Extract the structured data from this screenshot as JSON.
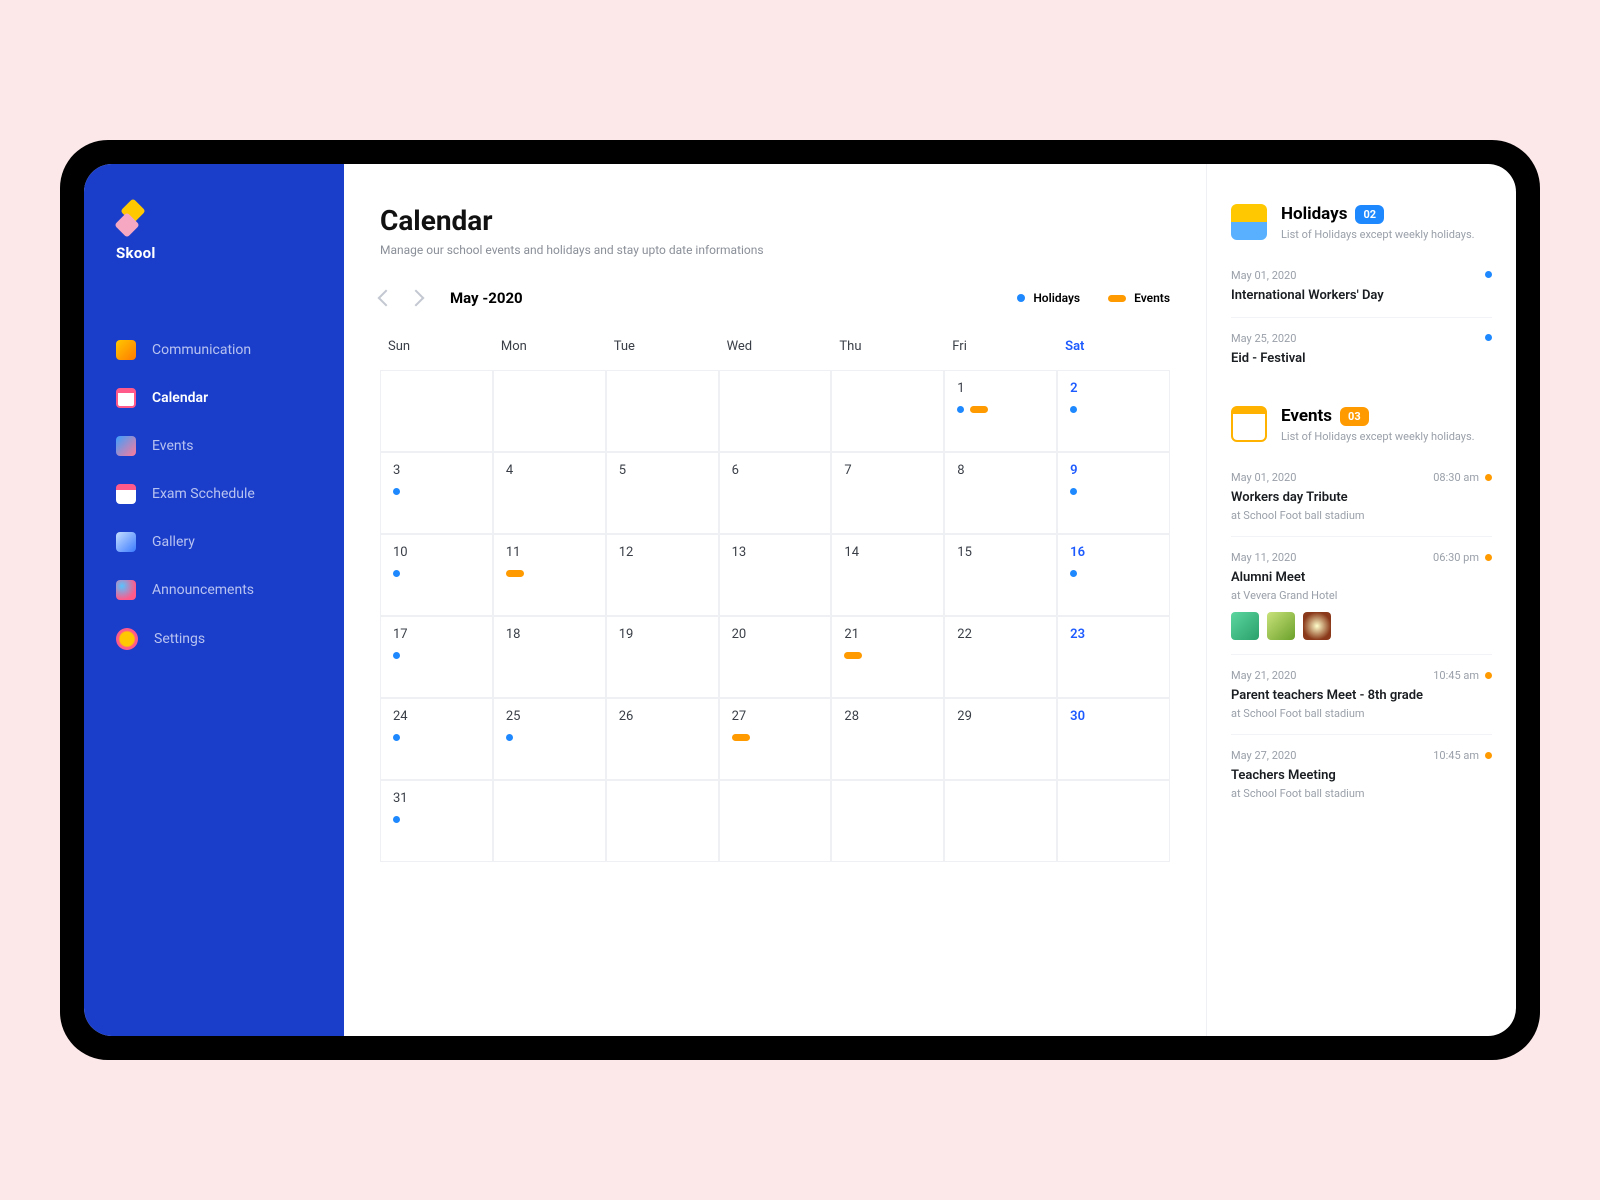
{
  "brand": "Skool",
  "sidebar": {
    "items": [
      {
        "label": "Communication"
      },
      {
        "label": "Calendar"
      },
      {
        "label": "Events"
      },
      {
        "label": "Exam Scchedule"
      },
      {
        "label": "Gallery"
      },
      {
        "label": "Announcements"
      },
      {
        "label": "Settings"
      }
    ]
  },
  "page": {
    "title": "Calendar",
    "subtitle": "Manage our school events and holidays  and stay upto date informations"
  },
  "calendar": {
    "month_label": "May -2020",
    "legend_holidays": "Holidays",
    "legend_events": "Events",
    "weekdays": [
      "Sun",
      "Mon",
      "Tue",
      "Wed",
      "Thu",
      "Fri",
      "Sat"
    ],
    "cells": [
      [
        {
          "n": ""
        },
        {
          "n": ""
        },
        {
          "n": ""
        },
        {
          "n": ""
        },
        {
          "n": ""
        },
        {
          "n": "1",
          "blue": true,
          "orange": true
        },
        {
          "n": "2",
          "blue": true,
          "sat": true
        }
      ],
      [
        {
          "n": "3",
          "blue": true
        },
        {
          "n": "4"
        },
        {
          "n": "5"
        },
        {
          "n": "6"
        },
        {
          "n": "7"
        },
        {
          "n": "8"
        },
        {
          "n": "9",
          "blue": true,
          "sat": true
        }
      ],
      [
        {
          "n": "10",
          "blue": true
        },
        {
          "n": "11",
          "orange": true
        },
        {
          "n": "12"
        },
        {
          "n": "13"
        },
        {
          "n": "14"
        },
        {
          "n": "15"
        },
        {
          "n": "16",
          "blue": true,
          "sat": true
        }
      ],
      [
        {
          "n": "17",
          "blue": true
        },
        {
          "n": "18"
        },
        {
          "n": "19"
        },
        {
          "n": "20"
        },
        {
          "n": "21",
          "orange": true
        },
        {
          "n": "22"
        },
        {
          "n": "23",
          "sat": true
        }
      ],
      [
        {
          "n": "24",
          "blue": true
        },
        {
          "n": "25",
          "blue": true
        },
        {
          "n": "26"
        },
        {
          "n": "27",
          "orange": true
        },
        {
          "n": "28"
        },
        {
          "n": "29"
        },
        {
          "n": "30",
          "sat": true
        }
      ],
      [
        {
          "n": "31",
          "blue": true
        },
        {
          "n": ""
        },
        {
          "n": ""
        },
        {
          "n": ""
        },
        {
          "n": ""
        },
        {
          "n": ""
        },
        {
          "n": ""
        }
      ]
    ]
  },
  "right": {
    "holidays": {
      "title": "Holidays",
      "count": "02",
      "subtitle": "List of Holidays except weekly holidays.",
      "items": [
        {
          "date": "May 01, 2020",
          "title": "International Workers' Day"
        },
        {
          "date": "May 25, 2020",
          "title": "Eid - Festival"
        }
      ]
    },
    "events": {
      "title": "Events",
      "count": "03",
      "subtitle": "List of Holidays except weekly holidays.",
      "items": [
        {
          "date": "May 01, 2020",
          "time": "08:30 am",
          "title": "Workers day Tribute",
          "loc": "at School Foot ball stadium"
        },
        {
          "date": "May 11, 2020",
          "time": "06:30 pm",
          "title": "Alumni Meet",
          "loc": "at Vevera Grand Hotel",
          "thumbs": true
        },
        {
          "date": "May 21, 2020",
          "time": "10:45 am",
          "title": "Parent teachers Meet - 8th grade",
          "loc": "at School Foot ball stadium"
        },
        {
          "date": "May 27, 2020",
          "time": "10:45 am",
          "title": "Teachers Meeting",
          "loc": "at School Foot ball stadium"
        }
      ]
    }
  }
}
